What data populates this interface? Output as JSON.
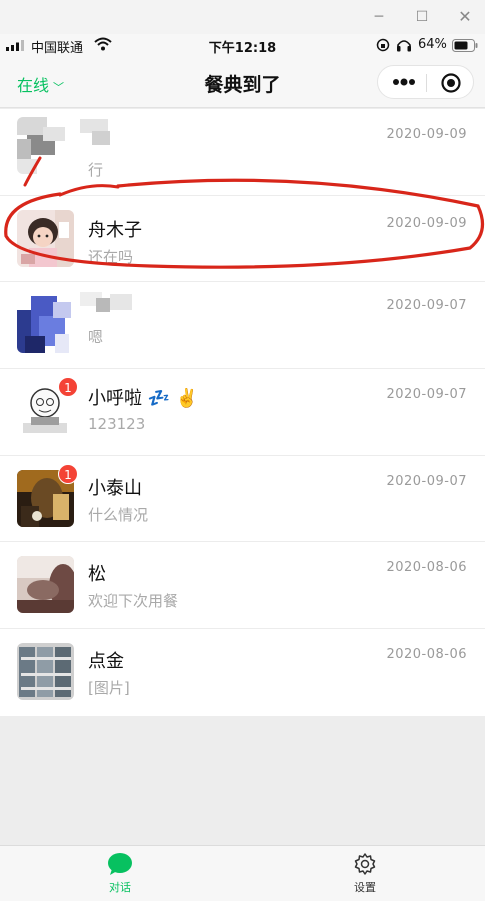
{
  "window": {
    "minimize": "─",
    "maximize": "☐",
    "close": "✕"
  },
  "status": {
    "carrier": "中国联通",
    "time": "下午12:18",
    "battery": "64%"
  },
  "nav": {
    "online_label": "在线",
    "title": "餐典到了"
  },
  "chats": [
    {
      "name": "",
      "message": "行",
      "date": "2020-09-09",
      "badge": ""
    },
    {
      "name": "舟木子",
      "message": "还在吗",
      "date": "2020-09-09",
      "badge": ""
    },
    {
      "name": "",
      "message": "嗯",
      "date": "2020-09-07",
      "badge": ""
    },
    {
      "name": "小呼啦 💤 ✌️",
      "message": "123123",
      "date": "2020-09-07",
      "badge": "1"
    },
    {
      "name": "小泰山",
      "message": "什么情况",
      "date": "2020-09-07",
      "badge": "1"
    },
    {
      "name": "松",
      "message": "欢迎下次用餐",
      "date": "2020-08-06",
      "badge": ""
    },
    {
      "name": "点金",
      "message": "[图片]",
      "date": "2020-08-06",
      "badge": ""
    }
  ],
  "tabs": {
    "talk": "对话",
    "settings": "设置"
  },
  "colors": {
    "accent": "#07c160",
    "badge": "#f44336",
    "annotation": "#d8261a"
  }
}
